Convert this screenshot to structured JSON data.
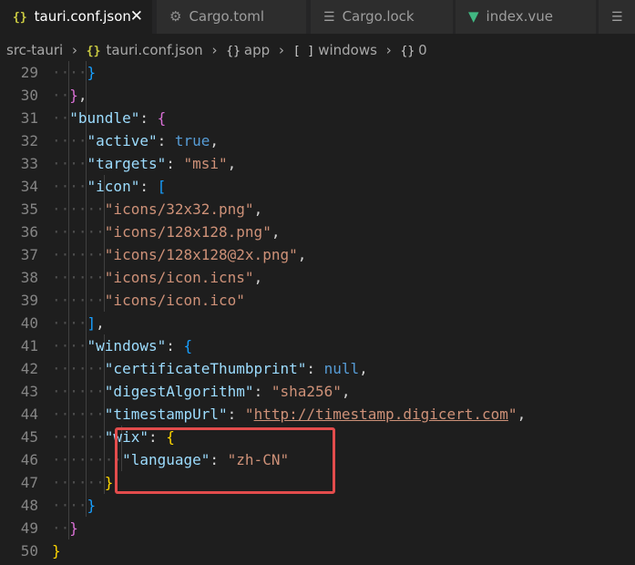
{
  "tabs": [
    {
      "icon": "json-braces-icon",
      "label": "tauri.conf.json",
      "active": true,
      "close": "✕"
    },
    {
      "icon": "gear-icon",
      "label": "Cargo.toml",
      "active": false
    },
    {
      "icon": "lines-icon",
      "label": "Cargo.lock",
      "active": false
    },
    {
      "icon": "vue-icon",
      "label": "index.vue",
      "active": false
    }
  ],
  "breadcrumb": {
    "folder": "src-tauri",
    "file": "tauri.conf.json",
    "app": "app",
    "windows": "windows",
    "index": "0"
  },
  "editor": {
    "lines": [
      {
        "n": "29",
        "indent": 2,
        "tokens": [
          [
            "}",
            "br3"
          ]
        ]
      },
      {
        "n": "30",
        "indent": 1,
        "tokens": [
          [
            "}",
            "br2"
          ],
          [
            ",",
            "p"
          ]
        ]
      },
      {
        "n": "31",
        "indent": 1,
        "tokens": [
          [
            "\"bundle\"",
            "k"
          ],
          [
            ": ",
            "p"
          ],
          [
            "{",
            "br2"
          ]
        ]
      },
      {
        "n": "32",
        "indent": 2,
        "tokens": [
          [
            "\"active\"",
            "k"
          ],
          [
            ": ",
            "p"
          ],
          [
            "true",
            "b"
          ],
          [
            ",",
            "p"
          ]
        ]
      },
      {
        "n": "33",
        "indent": 2,
        "tokens": [
          [
            "\"targets\"",
            "k"
          ],
          [
            ": ",
            "p"
          ],
          [
            "\"msi\"",
            "s"
          ],
          [
            ",",
            "p"
          ]
        ]
      },
      {
        "n": "34",
        "indent": 2,
        "tokens": [
          [
            "\"icon\"",
            "k"
          ],
          [
            ": ",
            "p"
          ],
          [
            "[",
            "br3"
          ]
        ]
      },
      {
        "n": "35",
        "indent": 3,
        "tokens": [
          [
            "\"icons/32x32.png\"",
            "s"
          ],
          [
            ",",
            "p"
          ]
        ]
      },
      {
        "n": "36",
        "indent": 3,
        "tokens": [
          [
            "\"icons/128x128.png\"",
            "s"
          ],
          [
            ",",
            "p"
          ]
        ]
      },
      {
        "n": "37",
        "indent": 3,
        "tokens": [
          [
            "\"icons/128x128@2x.png\"",
            "s"
          ],
          [
            ",",
            "p"
          ]
        ]
      },
      {
        "n": "38",
        "indent": 3,
        "tokens": [
          [
            "\"icons/icon.icns\"",
            "s"
          ],
          [
            ",",
            "p"
          ]
        ]
      },
      {
        "n": "39",
        "indent": 3,
        "tokens": [
          [
            "\"icons/icon.ico\"",
            "s"
          ]
        ]
      },
      {
        "n": "40",
        "indent": 2,
        "tokens": [
          [
            "]",
            "br3"
          ],
          [
            ",",
            "p"
          ]
        ]
      },
      {
        "n": "41",
        "indent": 2,
        "tokens": [
          [
            "\"windows\"",
            "k"
          ],
          [
            ": ",
            "p"
          ],
          [
            "{",
            "br3"
          ]
        ]
      },
      {
        "n": "42",
        "indent": 3,
        "tokens": [
          [
            "\"certificateThumbprint\"",
            "k"
          ],
          [
            ": ",
            "p"
          ],
          [
            "null",
            "b"
          ],
          [
            ",",
            "p"
          ]
        ]
      },
      {
        "n": "43",
        "indent": 3,
        "tokens": [
          [
            "\"digestAlgorithm\"",
            "k"
          ],
          [
            ": ",
            "p"
          ],
          [
            "\"sha256\"",
            "s"
          ],
          [
            ",",
            "p"
          ]
        ]
      },
      {
        "n": "44",
        "indent": 3,
        "tokens": [
          [
            "\"timestampUrl\"",
            "k"
          ],
          [
            ": ",
            "p"
          ],
          [
            "\"",
            "s"
          ],
          [
            "http://timestamp.digicert.com",
            "u"
          ],
          [
            "\"",
            "s"
          ],
          [
            ",",
            "p"
          ]
        ]
      },
      {
        "n": "45",
        "indent": 3,
        "tokens": [
          [
            "\"wix\"",
            "k"
          ],
          [
            ": ",
            "p"
          ],
          [
            "{",
            "br1"
          ]
        ]
      },
      {
        "n": "46",
        "indent": 4,
        "tokens": [
          [
            "\"language\"",
            "k"
          ],
          [
            ": ",
            "p"
          ],
          [
            "\"zh-CN\"",
            "s"
          ]
        ]
      },
      {
        "n": "47",
        "indent": 3,
        "tokens": [
          [
            "}",
            "br1"
          ]
        ]
      },
      {
        "n": "48",
        "indent": 2,
        "tokens": [
          [
            "}",
            "br3"
          ]
        ]
      },
      {
        "n": "49",
        "indent": 1,
        "tokens": [
          [
            "}",
            "br2"
          ]
        ]
      },
      {
        "n": "50",
        "indent": 0,
        "tokens": [
          [
            "}",
            "br1"
          ]
        ]
      }
    ]
  },
  "colors": {
    "highlight_box": "#e34c4c",
    "editor_bg": "#1e1e1e"
  }
}
